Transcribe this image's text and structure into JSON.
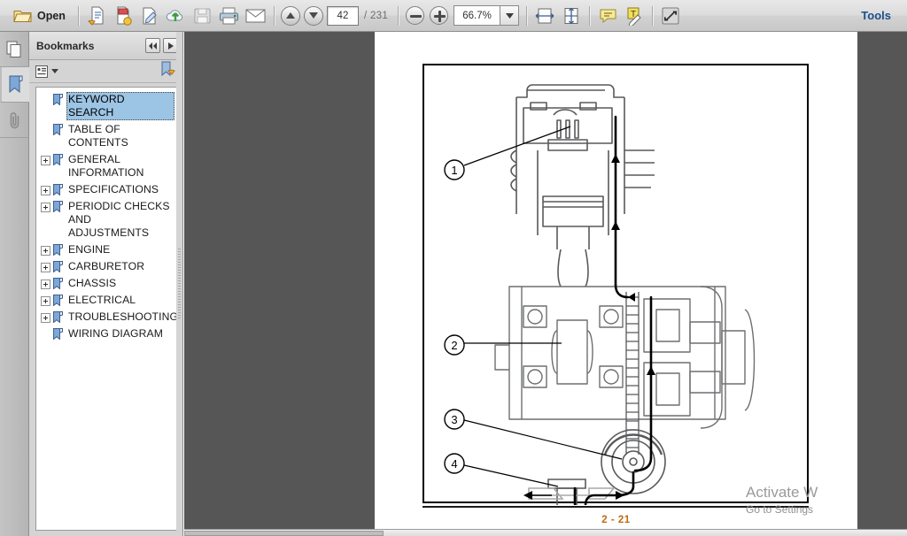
{
  "toolbar": {
    "open_label": "Open",
    "tools_label": "Tools",
    "page_current": "42",
    "page_total": "/ 231",
    "zoom_value": "66.7%",
    "icons": [
      "open-folder-icon",
      "save-as-other-icon",
      "create-pdf-icon",
      "edit-pdf-icon",
      "upload-cloud-icon",
      "save-icon",
      "print-icon",
      "email-icon",
      "previous-page-icon",
      "next-page-icon",
      "zoom-out-icon",
      "zoom-in-icon",
      "zoom-dropdown-icon",
      "fit-width-icon",
      "fit-page-icon",
      "comment-icon",
      "highlight-text-icon",
      "fullscreen-icon"
    ]
  },
  "rail": {
    "items": [
      {
        "name": "page-thumbnails",
        "icon": "pages-icon",
        "active": false
      },
      {
        "name": "bookmarks",
        "icon": "bookmark-icon",
        "active": true
      },
      {
        "name": "attachments",
        "icon": "paperclip-icon",
        "active": false
      }
    ]
  },
  "panel": {
    "title": "Bookmarks",
    "nav_prev": "collapse-all-icon",
    "nav_next": "expand-icon",
    "options_icon": "options-menu-icon",
    "new_bookmark_icon": "new-bookmark-icon",
    "bookmarks": [
      {
        "label": "KEYWORD SEARCH",
        "expandable": false,
        "selected": true
      },
      {
        "label": "TABLE OF CONTENTS",
        "expandable": false,
        "selected": false
      },
      {
        "label": "GENERAL INFORMATION",
        "expandable": true,
        "selected": false
      },
      {
        "label": "SPECIFICATIONS",
        "expandable": true,
        "selected": false
      },
      {
        "label": "PERIODIC CHECKS AND ADJUSTMENTS",
        "expandable": true,
        "selected": false
      },
      {
        "label": "ENGINE",
        "expandable": true,
        "selected": false
      },
      {
        "label": "CARBURETOR",
        "expandable": true,
        "selected": false
      },
      {
        "label": "CHASSIS",
        "expandable": true,
        "selected": false
      },
      {
        "label": "ELECTRICAL",
        "expandable": true,
        "selected": false
      },
      {
        "label": "TROUBLESHOOTING",
        "expandable": true,
        "selected": false
      },
      {
        "label": "WIRING DIAGRAM",
        "expandable": false,
        "selected": false
      }
    ]
  },
  "document": {
    "page_label": "2 - 21",
    "callouts": [
      "1",
      "2",
      "3",
      "4"
    ]
  },
  "watermark": {
    "line1": "Activate W",
    "line2": "Go to Settings"
  },
  "colors": {
    "toolbar_bg": "#dcdcdc",
    "doc_bg": "#565656",
    "panel_bg": "#d4d4d4",
    "selection": "#9cc4e4",
    "tools_link": "#1b4f8a",
    "page_number": "#c06a12"
  }
}
